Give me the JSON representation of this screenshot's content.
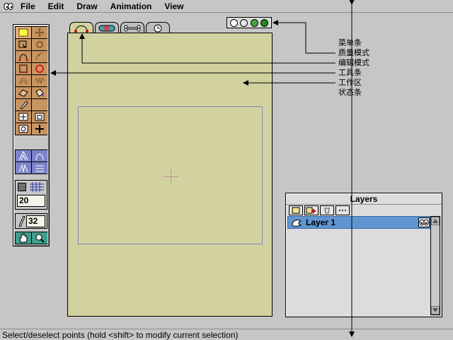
{
  "menubar": {
    "items": [
      "File",
      "Edit",
      "Draw",
      "Animation",
      "View"
    ]
  },
  "toolbar": {
    "grid_size": "20",
    "brush_size": "32",
    "tool_icons": [
      "select-icon",
      "pan-icon",
      "subselect-icon",
      "rotate-icon",
      "curve-icon",
      "add-point-icon",
      "rectangle-icon",
      "oval-icon",
      "arch-icon",
      "wave-icon",
      "eraser-icon",
      "fill-icon",
      "pencil-icon",
      "blank",
      "translate-icon",
      "scale-icon",
      "rotate-layer-icon",
      "plus-icon"
    ]
  },
  "document": {
    "tabs": [
      "draw-tab",
      "color-tab",
      "bone-tab",
      "time-tab"
    ]
  },
  "mode_buttons": {
    "colors": [
      "#ffffff",
      "#e6e6e6",
      "#44aa44",
      "#228822"
    ]
  },
  "layers": {
    "title": "Layers",
    "items": [
      {
        "name": "Layer 1",
        "selected": true
      }
    ]
  },
  "status": {
    "text": "Select/deselect points (hold <shift> to modify current selection)"
  },
  "annotations": {
    "labels": [
      "菜单条",
      "质量模式",
      "编辑模式",
      "工具条",
      "工作区",
      "状态条"
    ]
  },
  "colors": {
    "canvas": "#d2d2a0",
    "tool_bg": "#c89462",
    "tool_blue": "#7c83c9",
    "tool_teal": "#3e9e8e",
    "layer_selected": "#5f96d2"
  }
}
